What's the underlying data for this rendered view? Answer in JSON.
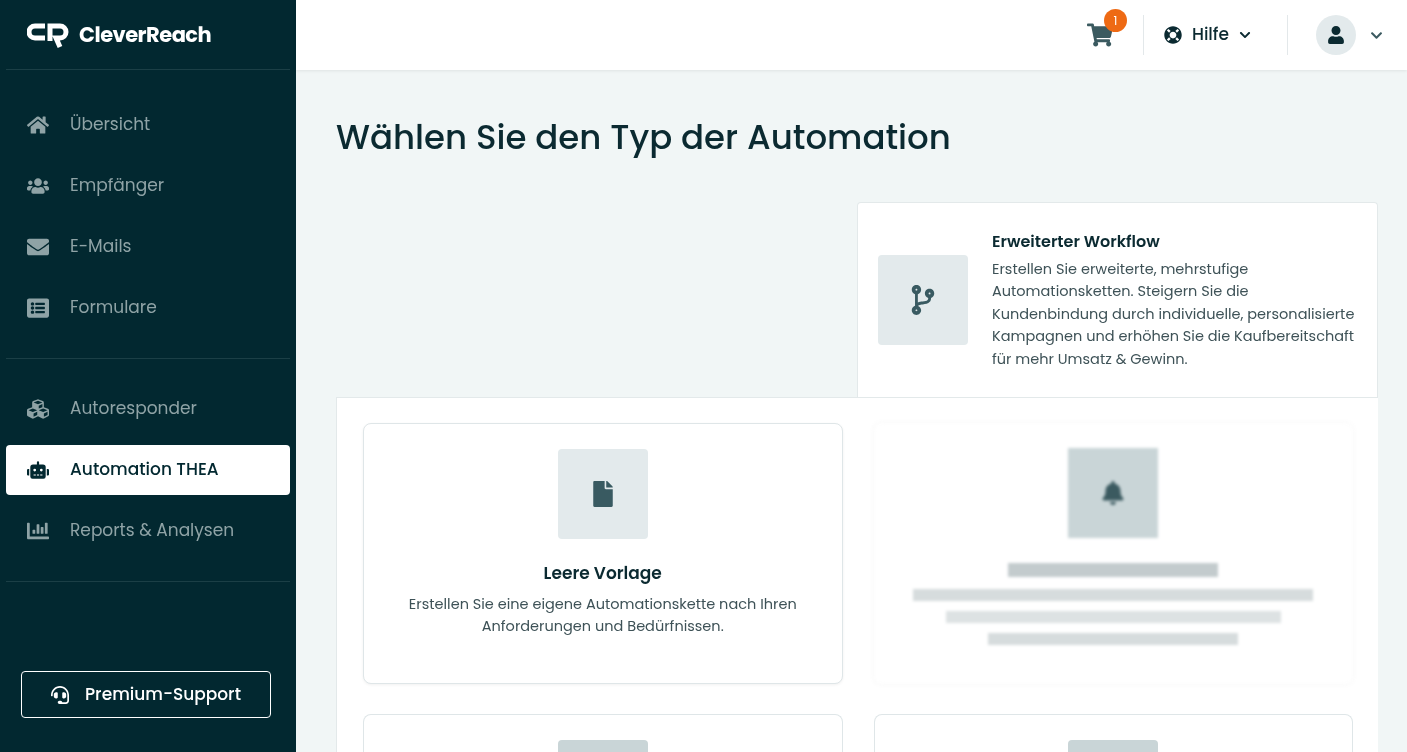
{
  "brand": {
    "name": "CleverReach"
  },
  "sidebar": {
    "groups": [
      [
        {
          "label": "Übersicht",
          "selected": false
        },
        {
          "label": "Empfänger",
          "selected": false
        },
        {
          "label": "E-Mails",
          "selected": false
        },
        {
          "label": "Formulare",
          "selected": false
        }
      ],
      [
        {
          "label": "Autoresponder",
          "selected": false
        },
        {
          "label": "Automation THEA",
          "selected": true
        },
        {
          "label": "Reports & Analysen",
          "selected": false
        }
      ]
    ],
    "support_button": "Premium-Support"
  },
  "header": {
    "cart_count": "1",
    "help": "Hilfe"
  },
  "title": "Wählen Sie den Typ der Automation",
  "featured": {
    "title": "Erweiterter Workflow",
    "description": "Erstellen Sie erweiterte, mehrstufige Automationsketten. Steigern Sie die Kundenbindung durch individuelle, personalisierte Kampagnen und erhöhen Sie die Kaufbereitschaft für mehr Umsatz & Gewinn."
  },
  "cards": [
    {
      "kind": "template",
      "title": "Leere Vorlage",
      "description": "Erstellen Sie eine eigene Automationskette nach Ihren Anforderungen und Bedürfnissen."
    },
    {
      "kind": "blurred"
    },
    {
      "kind": "partial"
    },
    {
      "kind": "partial"
    }
  ]
}
